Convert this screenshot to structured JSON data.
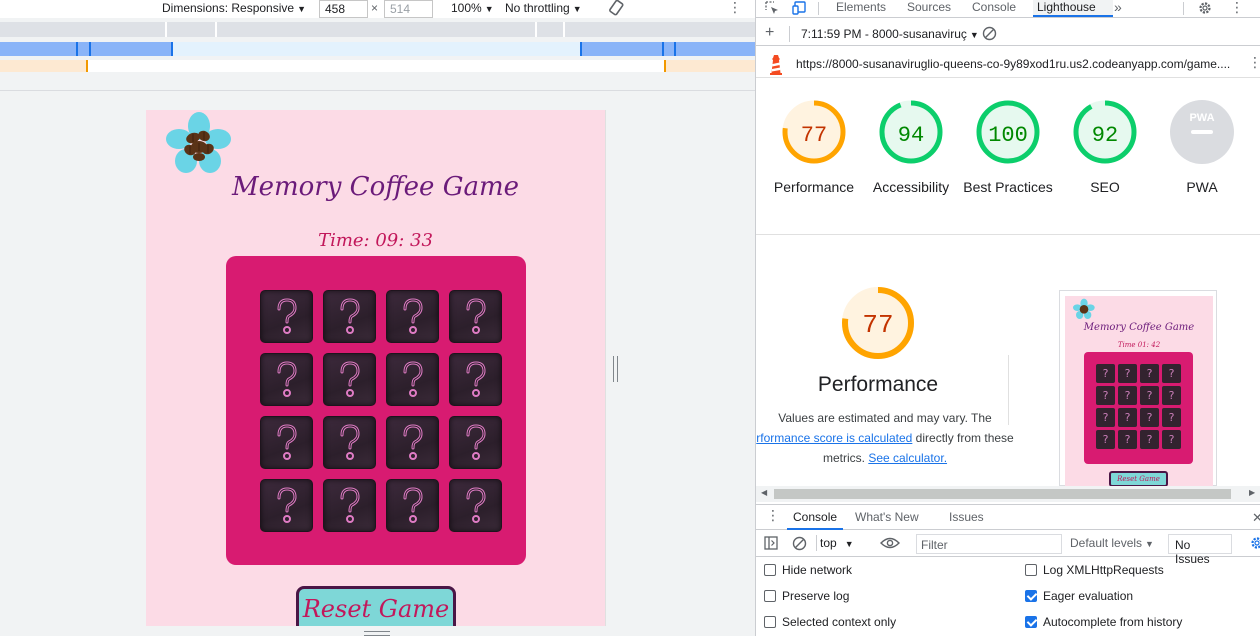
{
  "device_toolbar": {
    "dimensions_label": "Dimensions: Responsive",
    "width": "458",
    "times": "×",
    "height": "514",
    "zoom": "100%",
    "throttling": "No throttling"
  },
  "game": {
    "title": "Memory Coffee Game",
    "timer": "Time: 09: 33",
    "card_glyph": "?",
    "card_count": 16,
    "reset_label": "Reset Game",
    "colors": {
      "page_bg": "#fcdbe6",
      "board": "#d81b71",
      "title": "#6b1b7a",
      "button": "#7ed7d7"
    }
  },
  "devtools": {
    "tabs": [
      "Elements",
      "Sources",
      "Console",
      "Lighthouse"
    ],
    "active_tab": "Lighthouse",
    "more_tabs": "»",
    "report_label": "7:11:59 PM - 8000-susanaviruç",
    "url": "https://8000-susanaviruglio-queens-co-9y89xod1ru.us2.codeanyapp.com/game...."
  },
  "lighthouse": {
    "scores": [
      {
        "label": "Performance",
        "value": "77",
        "score": 77,
        "color": "#ffa400",
        "fill": "#fff3e0",
        "text_color": "#c33300"
      },
      {
        "label": "Accessibility",
        "value": "94",
        "score": 94,
        "color": "#0cce6b",
        "fill": "#e6f9ef",
        "text_color": "#008800"
      },
      {
        "label": "Best Practices",
        "value": "100",
        "score": 100,
        "color": "#0cce6b",
        "fill": "#e6f9ef",
        "text_color": "#008800"
      },
      {
        "label": "SEO",
        "value": "92",
        "score": 92,
        "color": "#0cce6b",
        "fill": "#e6f9ef",
        "text_color": "#008800"
      },
      {
        "label": "PWA",
        "value": "PWA",
        "score": 0,
        "color": "#dadce0",
        "fill": "#dadce0",
        "text_color": "#ffffff"
      }
    ],
    "performance": {
      "score": "77",
      "title": "Performance",
      "desc_line1": "Values are estimated and may vary. The",
      "desc_link": "rformance score is calculated",
      "desc_after_link": " directly from these",
      "desc_line3": "metrics. ",
      "calc_link": "See calculator."
    },
    "thumbnail": {
      "title": "Memory Coffee Game",
      "timer": "Time 01: 42",
      "reset_label": "Reset Game"
    }
  },
  "drawer": {
    "tabs": [
      "Console",
      "What's New",
      "Issues"
    ],
    "active_tab": "Console",
    "context": "top",
    "filter_placeholder": "Filter",
    "levels": "Default levels",
    "issues": "No Issues",
    "options": [
      {
        "label": "Hide network",
        "checked": false
      },
      {
        "label": "Log XMLHttpRequests",
        "checked": false
      },
      {
        "label": "Preserve log",
        "checked": false
      },
      {
        "label": "Eager evaluation",
        "checked": true
      },
      {
        "label": "Selected context only",
        "checked": false
      },
      {
        "label": "Autocomplete from history",
        "checked": true
      }
    ]
  }
}
